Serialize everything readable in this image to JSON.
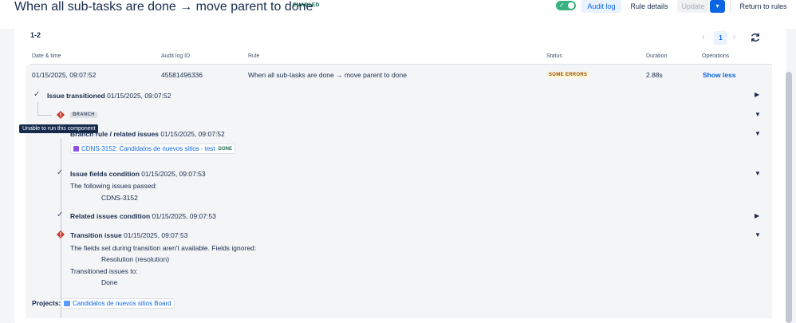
{
  "header": {
    "title": "When all sub-tasks are done → move parent to done",
    "status_lozenge": "ENABLED",
    "toggle_icon": "check-icon",
    "buttons": {
      "audit_log": "Audit log",
      "rule_details": "Rule details",
      "update": "Update",
      "dropdown": "▾",
      "return": "Return to rules"
    }
  },
  "audit": {
    "count": "1-2",
    "pagination": {
      "current_page": "1",
      "prev": "‹",
      "next": "›"
    },
    "columns": [
      "Date & time",
      "Audit log ID",
      "Rule",
      "Status",
      "Duration",
      "Operations"
    ],
    "row": {
      "datetime": "01/15/2025, 09:07:52",
      "log_id": "45581496336",
      "rule": "When all sub-tasks are done → move parent to done",
      "status": "SOME ERRORS",
      "duration": "2.88s",
      "operation": "Show less"
    }
  },
  "details": {
    "issue_transitioned": {
      "label": "Issue transitioned",
      "time": "01/15/2025, 09:07:52"
    },
    "branch_lozenge": "BRANCH",
    "tooltip": "Unable to run this component",
    "branch_rule": {
      "label": "Branch rule / related issues",
      "time": "01/15/2025, 09:07:52"
    },
    "issue_chip": {
      "key": "CDNS-3152: Candidatos de nuevos sitios - test",
      "status": "DONE"
    },
    "fields_condition": {
      "label": "Issue fields condition",
      "time": "01/15/2025, 09:07:53",
      "line1": "The following issues passed:",
      "line2": "CDNS-3152"
    },
    "related_condition": {
      "label": "Related issues condition",
      "time": "01/15/2025, 09:07:53"
    },
    "transition_issue": {
      "label": "Transition issue",
      "time": "01/15/2025, 09:07:53",
      "line1": "The fields set during transition aren't available. Fields ignored:",
      "line2": "Resolution (resolution)",
      "line3": "Transitioned issues to:",
      "line4": "Done"
    },
    "projects": {
      "label": "Projects:",
      "name": "Candidatos de nuevos sitios Board"
    }
  },
  "colors": {
    "accent": "#0c66e4",
    "toggle_on": "#36b37e",
    "error": "#c9372c",
    "warning_bg": "#fff7d6"
  }
}
